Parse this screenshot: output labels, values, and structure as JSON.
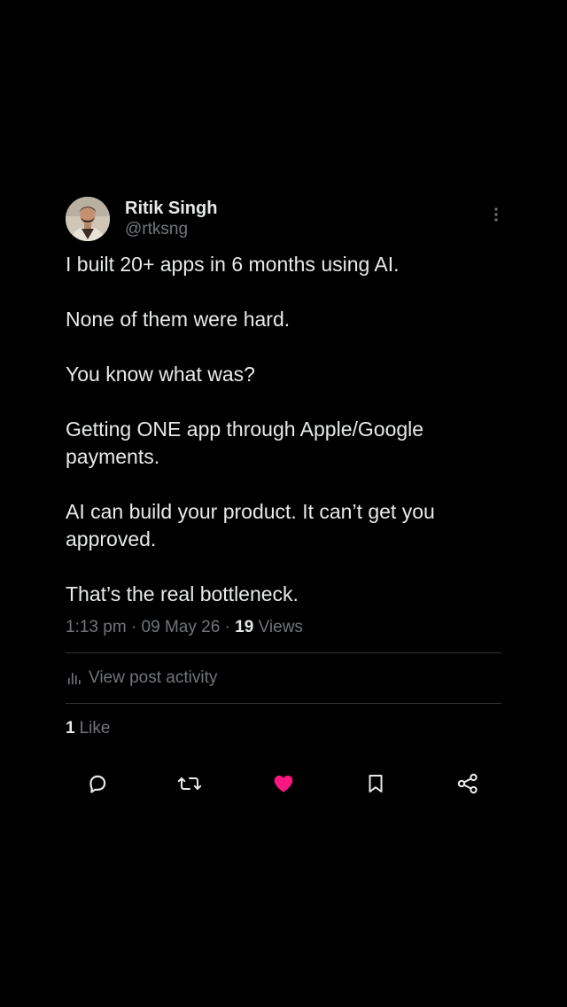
{
  "post": {
    "author": {
      "display_name": "Ritik Singh",
      "handle": "@rtksng"
    },
    "paragraphs": [
      "I built 20+ apps in 6 months using AI.",
      "None of them were hard.",
      "You know what was?",
      "Getting ONE app through Apple/Google payments.",
      "AI can build your product. It can’t get you approved.",
      "That’s the real bottleneck."
    ],
    "meta": {
      "time": "1:13 pm",
      "separator1": " · ",
      "date": "09 May 26",
      "separator2": " · ",
      "views_count": "19",
      "views_label": " Views"
    },
    "activity_label": "View post activity",
    "likes": {
      "count": "1",
      "label": "Like"
    },
    "actions": {
      "reply_icon": "reply-icon",
      "repost_icon": "repost-icon",
      "like_icon": "heart-icon",
      "bookmark_icon": "bookmark-icon",
      "share_icon": "share-icon"
    }
  },
  "colors": {
    "background": "#000000",
    "text_primary": "#e7e9ea",
    "text_secondary": "#71767b",
    "divider": "#2f3336",
    "like_active": "#f91880"
  }
}
